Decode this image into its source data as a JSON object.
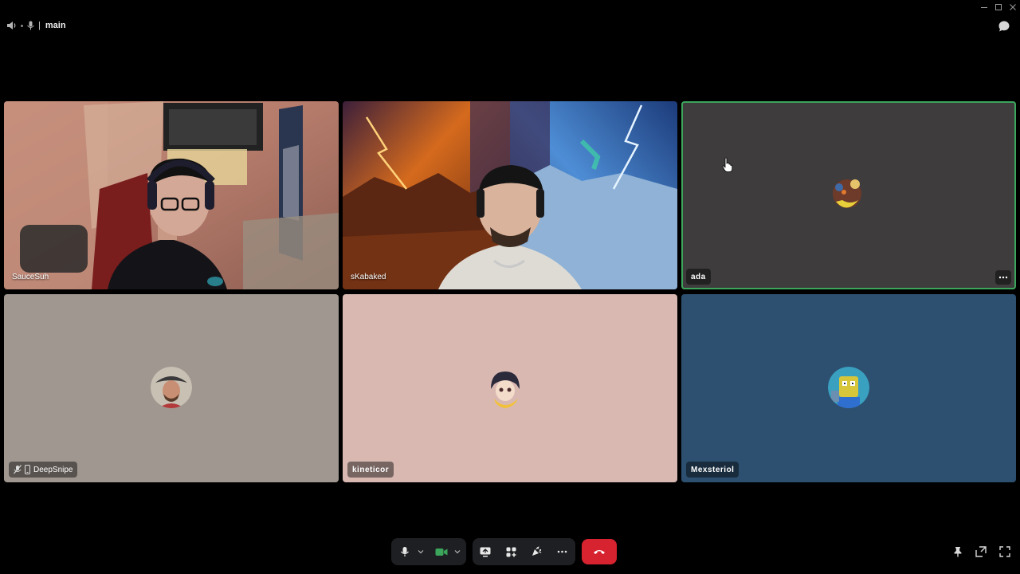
{
  "topbar": {
    "channel_name": "main",
    "separator": "|"
  },
  "tiles": [
    {
      "name": "SauceSuh",
      "type": "video"
    },
    {
      "name": "sKabaked",
      "type": "video"
    },
    {
      "name": "ada",
      "type": "avatar",
      "background": "#3e3c3d",
      "speaking": true
    },
    {
      "name": "DeepSnipe",
      "type": "avatar",
      "background": "#a09890",
      "muted": true,
      "mobile": true
    },
    {
      "name": "kineticor",
      "type": "avatar",
      "background": "#d9b8b2"
    },
    {
      "name": "Mexsteriol",
      "type": "avatar",
      "background": "#2d5070"
    }
  ],
  "controls": {
    "microphone": "microphone-icon",
    "camera": "video-camera-icon",
    "screen_share": "screen-share-icon",
    "activities": "activities-icon",
    "soundboard": "soundboard-icon",
    "more": "more-icon",
    "disconnect": "end-call-icon"
  },
  "colors": {
    "background": "#000000",
    "speaking_ring": "#3ba55c",
    "end_call": "#d6232f",
    "camera_on": "#3ba55c"
  }
}
